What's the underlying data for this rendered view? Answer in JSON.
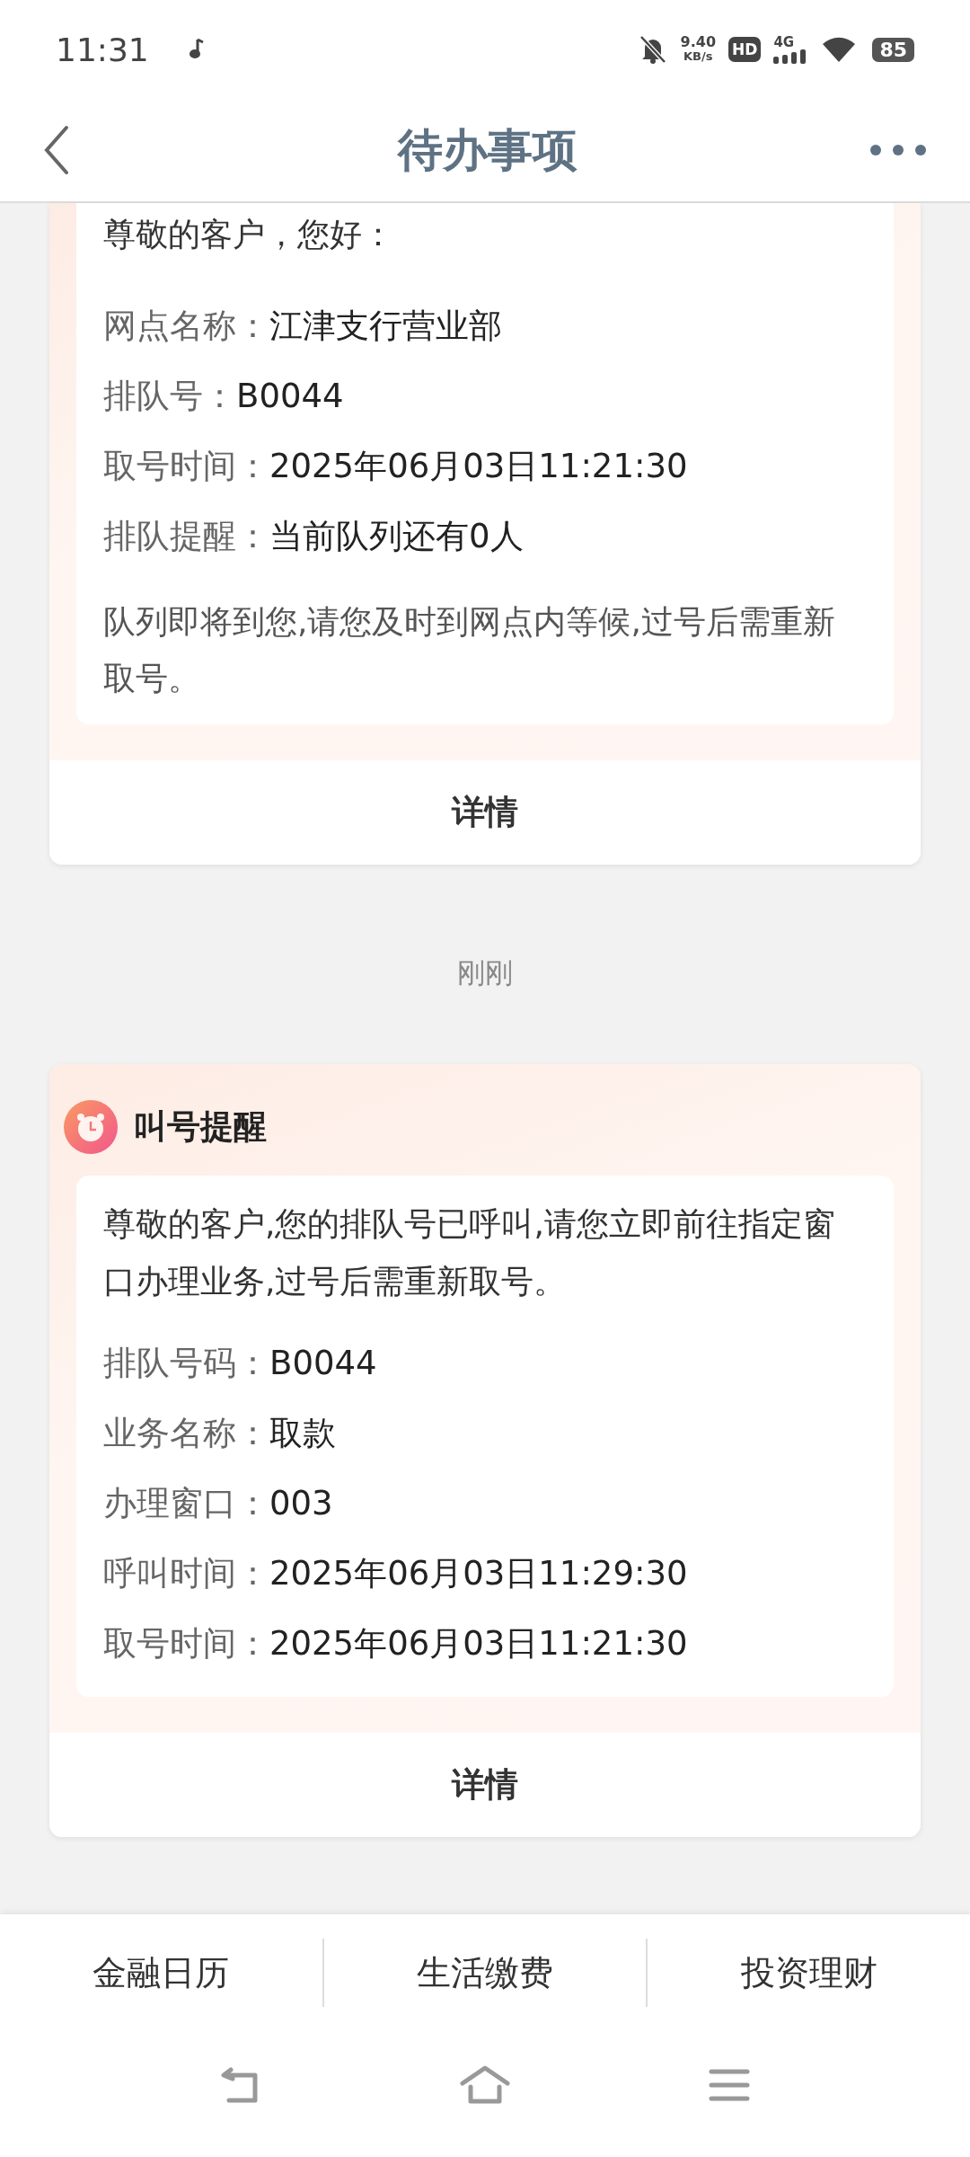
{
  "status_bar": {
    "time": "11:31",
    "net_speed": "9.40",
    "net_unit": "KB/s",
    "hd_badge": "HD",
    "network": "4G",
    "battery": "85"
  },
  "header": {
    "title": "待办事项"
  },
  "cards": [
    {
      "message": "尊敬的客户，您好：",
      "fields": [
        {
          "label": "网点名称：",
          "value": "江津支行营业部"
        },
        {
          "label": "排队号：",
          "value": "B0044"
        },
        {
          "label": "取号时间：",
          "value": "2025年06月03日11:21:30"
        },
        {
          "label": "排队提醒：",
          "value": "当前队列还有0人"
        }
      ],
      "note": "队列即将到您,请您及时到网点内等候,过号后需重新取号。",
      "action": "详情"
    },
    {
      "time": "刚刚",
      "title": "叫号提醒",
      "message": "尊敬的客户,您的排队号已呼叫,请您立即前往指定窗口办理业务,过号后需重新取号。",
      "fields": [
        {
          "label": "排队号码：",
          "value": "B0044"
        },
        {
          "label": "业务名称：",
          "value": "取款"
        },
        {
          "label": "办理窗口：",
          "value": "003"
        },
        {
          "label": "呼叫时间：",
          "value": "2025年06月03日11:29:30"
        },
        {
          "label": "取号时间：",
          "value": "2025年06月03日11:21:30"
        }
      ],
      "action": "详情"
    }
  ],
  "bottom_tabs": [
    "金融日历",
    "生活缴费",
    "投资理财"
  ]
}
